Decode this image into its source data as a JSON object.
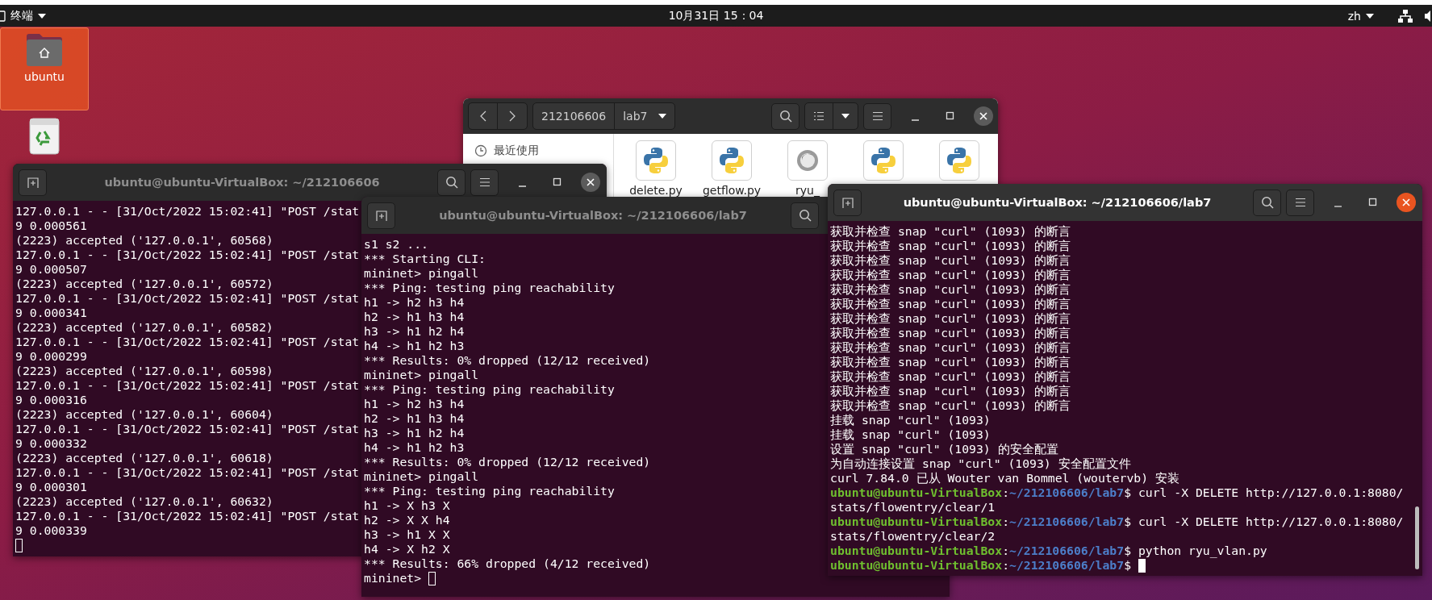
{
  "top_bar": {
    "app_menu": "终端",
    "clock": "10月31日  15：04",
    "input_method": "zh"
  },
  "desktop_icons": [
    {
      "label": "ubuntu",
      "kind": "home",
      "selected": true
    },
    {
      "kind": "trash",
      "selected": false
    }
  ],
  "file_manager": {
    "path": [
      {
        "label": "212106606"
      },
      {
        "label": "lab7"
      }
    ],
    "sidebar": [
      {
        "label": "最近使用"
      }
    ],
    "files": [
      {
        "name": "delete.py",
        "kind": "python"
      },
      {
        "name": "getflow.py",
        "kind": "python"
      },
      {
        "name": "ryu_",
        "kind": "generic"
      },
      {
        "kind": "python"
      },
      {
        "kind": "python"
      }
    ]
  },
  "terminals": [
    {
      "title": "ubuntu@ubuntu-VirtualBox: ~/212106606",
      "focused": false,
      "lines": [
        {
          "text": "127.0.0.1 - - [31/Oct/2022 15:02:41] \"POST /stat"
        },
        {
          "text": "9 0.000561"
        },
        {
          "text": "(2223) accepted ('127.0.0.1', 60568)"
        },
        {
          "text": "127.0.0.1 - - [31/Oct/2022 15:02:41] \"POST /stat"
        },
        {
          "text": "9 0.000507"
        },
        {
          "text": "(2223) accepted ('127.0.0.1', 60572)"
        },
        {
          "text": "127.0.0.1 - - [31/Oct/2022 15:02:41] \"POST /stat"
        },
        {
          "text": "9 0.000341"
        },
        {
          "text": "(2223) accepted ('127.0.0.1', 60582)"
        },
        {
          "text": "127.0.0.1 - - [31/Oct/2022 15:02:41] \"POST /stat"
        },
        {
          "text": "9 0.000299"
        },
        {
          "text": "(2223) accepted ('127.0.0.1', 60598)"
        },
        {
          "text": "127.0.0.1 - - [31/Oct/2022 15:02:41] \"POST /stat"
        },
        {
          "text": "9 0.000316"
        },
        {
          "text": "(2223) accepted ('127.0.0.1', 60604)"
        },
        {
          "text": "127.0.0.1 - - [31/Oct/2022 15:02:41] \"POST /stat"
        },
        {
          "text": "9 0.000332"
        },
        {
          "text": "(2223) accepted ('127.0.0.1', 60618)"
        },
        {
          "text": "127.0.0.1 - - [31/Oct/2022 15:02:41] \"POST /stat"
        },
        {
          "text": "9 0.000301"
        },
        {
          "text": "(2223) accepted ('127.0.0.1', 60632)"
        },
        {
          "text": "127.0.0.1 - - [31/Oct/2022 15:02:41] \"POST /stat"
        },
        {
          "text": "9 0.000339"
        },
        {
          "kind": "input"
        }
      ]
    },
    {
      "title": "ubuntu@ubuntu-VirtualBox: ~/212106606/lab7",
      "focused": false,
      "lines": [
        {
          "text": "s1 s2 ..."
        },
        {
          "text": "*** Starting CLI:"
        },
        {
          "text": "mininet> pingall"
        },
        {
          "text": "*** Ping: testing ping reachability"
        },
        {
          "text": "h1 -> h2 h3 h4"
        },
        {
          "text": "h2 -> h1 h3 h4"
        },
        {
          "text": "h3 -> h1 h2 h4"
        },
        {
          "text": "h4 -> h1 h2 h3"
        },
        {
          "text": "*** Results: 0% dropped (12/12 received)"
        },
        {
          "text": "mininet> pingall"
        },
        {
          "text": "*** Ping: testing ping reachability"
        },
        {
          "text": "h1 -> h2 h3 h4"
        },
        {
          "text": "h2 -> h1 h3 h4"
        },
        {
          "text": "h3 -> h1 h2 h4"
        },
        {
          "text": "h4 -> h1 h2 h3"
        },
        {
          "text": "*** Results: 0% dropped (12/12 received)"
        },
        {
          "text": "mininet> pingall"
        },
        {
          "text": "*** Ping: testing ping reachability"
        },
        {
          "text": "h1 -> X h3 X"
        },
        {
          "text": "h2 -> X X h4"
        },
        {
          "text": "h3 -> h1 X X"
        },
        {
          "text": "h4 -> X h2 X"
        },
        {
          "text": "*** Results: 66% dropped (4/12 received)"
        },
        {
          "text": "mininet>"
        }
      ]
    },
    {
      "title": "ubuntu@ubuntu-VirtualBox: ~/212106606/lab7",
      "focused": true,
      "lines": [
        {
          "text": "获取并检查 snap \"curl\" (1093) 的断言"
        },
        {
          "text": "获取并检查 snap \"curl\" (1093) 的断言"
        },
        {
          "text": "获取并检查 snap \"curl\" (1093) 的断言"
        },
        {
          "text": "获取并检查 snap \"curl\" (1093) 的断言"
        },
        {
          "text": "获取并检查 snap \"curl\" (1093) 的断言"
        },
        {
          "text": "获取并检查 snap \"curl\" (1093) 的断言"
        },
        {
          "text": "获取并检查 snap \"curl\" (1093) 的断言"
        },
        {
          "text": "获取并检查 snap \"curl\" (1093) 的断言"
        },
        {
          "text": "获取并检查 snap \"curl\" (1093) 的断言"
        },
        {
          "text": "获取并检查 snap \"curl\" (1093) 的断言"
        },
        {
          "text": "获取并检查 snap \"curl\" (1093) 的断言"
        },
        {
          "text": "获取并检查 snap \"curl\" (1093) 的断言"
        },
        {
          "text": "获取并检查 snap \"curl\" (1093) 的断言"
        },
        {
          "text": "挂载 snap \"curl\" (1093)"
        },
        {
          "text": "挂载 snap \"curl\" (1093)"
        },
        {
          "text": "设置 snap \"curl\" (1093) 的安全配置"
        },
        {
          "text": "为自动连接设置 snap \"curl\" (1093) 安全配置文件"
        },
        {
          "text": "curl 7.84.0 已从 Wouter van Bommel (woutervb) 安装"
        },
        {
          "kind": "prompt",
          "user": "ubuntu@ubuntu-VirtualBox",
          "sep": ":",
          "path": "~/212106606/lab7",
          "command": "$ curl -X DELETE http://127.0.0.1:8080/"
        },
        {
          "text": "stats/flowentry/clear/1"
        },
        {
          "kind": "prompt",
          "user": "ubuntu@ubuntu-VirtualBox",
          "sep": ":",
          "path": "~/212106606/lab7",
          "command": "$ curl -X DELETE http://127.0.0.1:8080/"
        },
        {
          "text": "stats/flowentry/clear/2"
        },
        {
          "kind": "prompt",
          "user": "ubuntu@ubuntu-VirtualBox",
          "sep": ":",
          "path": "~/212106606/lab7",
          "command": "$ python ryu_vlan.py"
        },
        {
          "kind": "prompt",
          "user": "ubuntu@ubuntu-VirtualBox",
          "sep": ":",
          "path": "~/212106606/lab7",
          "command": "$"
        }
      ]
    }
  ]
}
